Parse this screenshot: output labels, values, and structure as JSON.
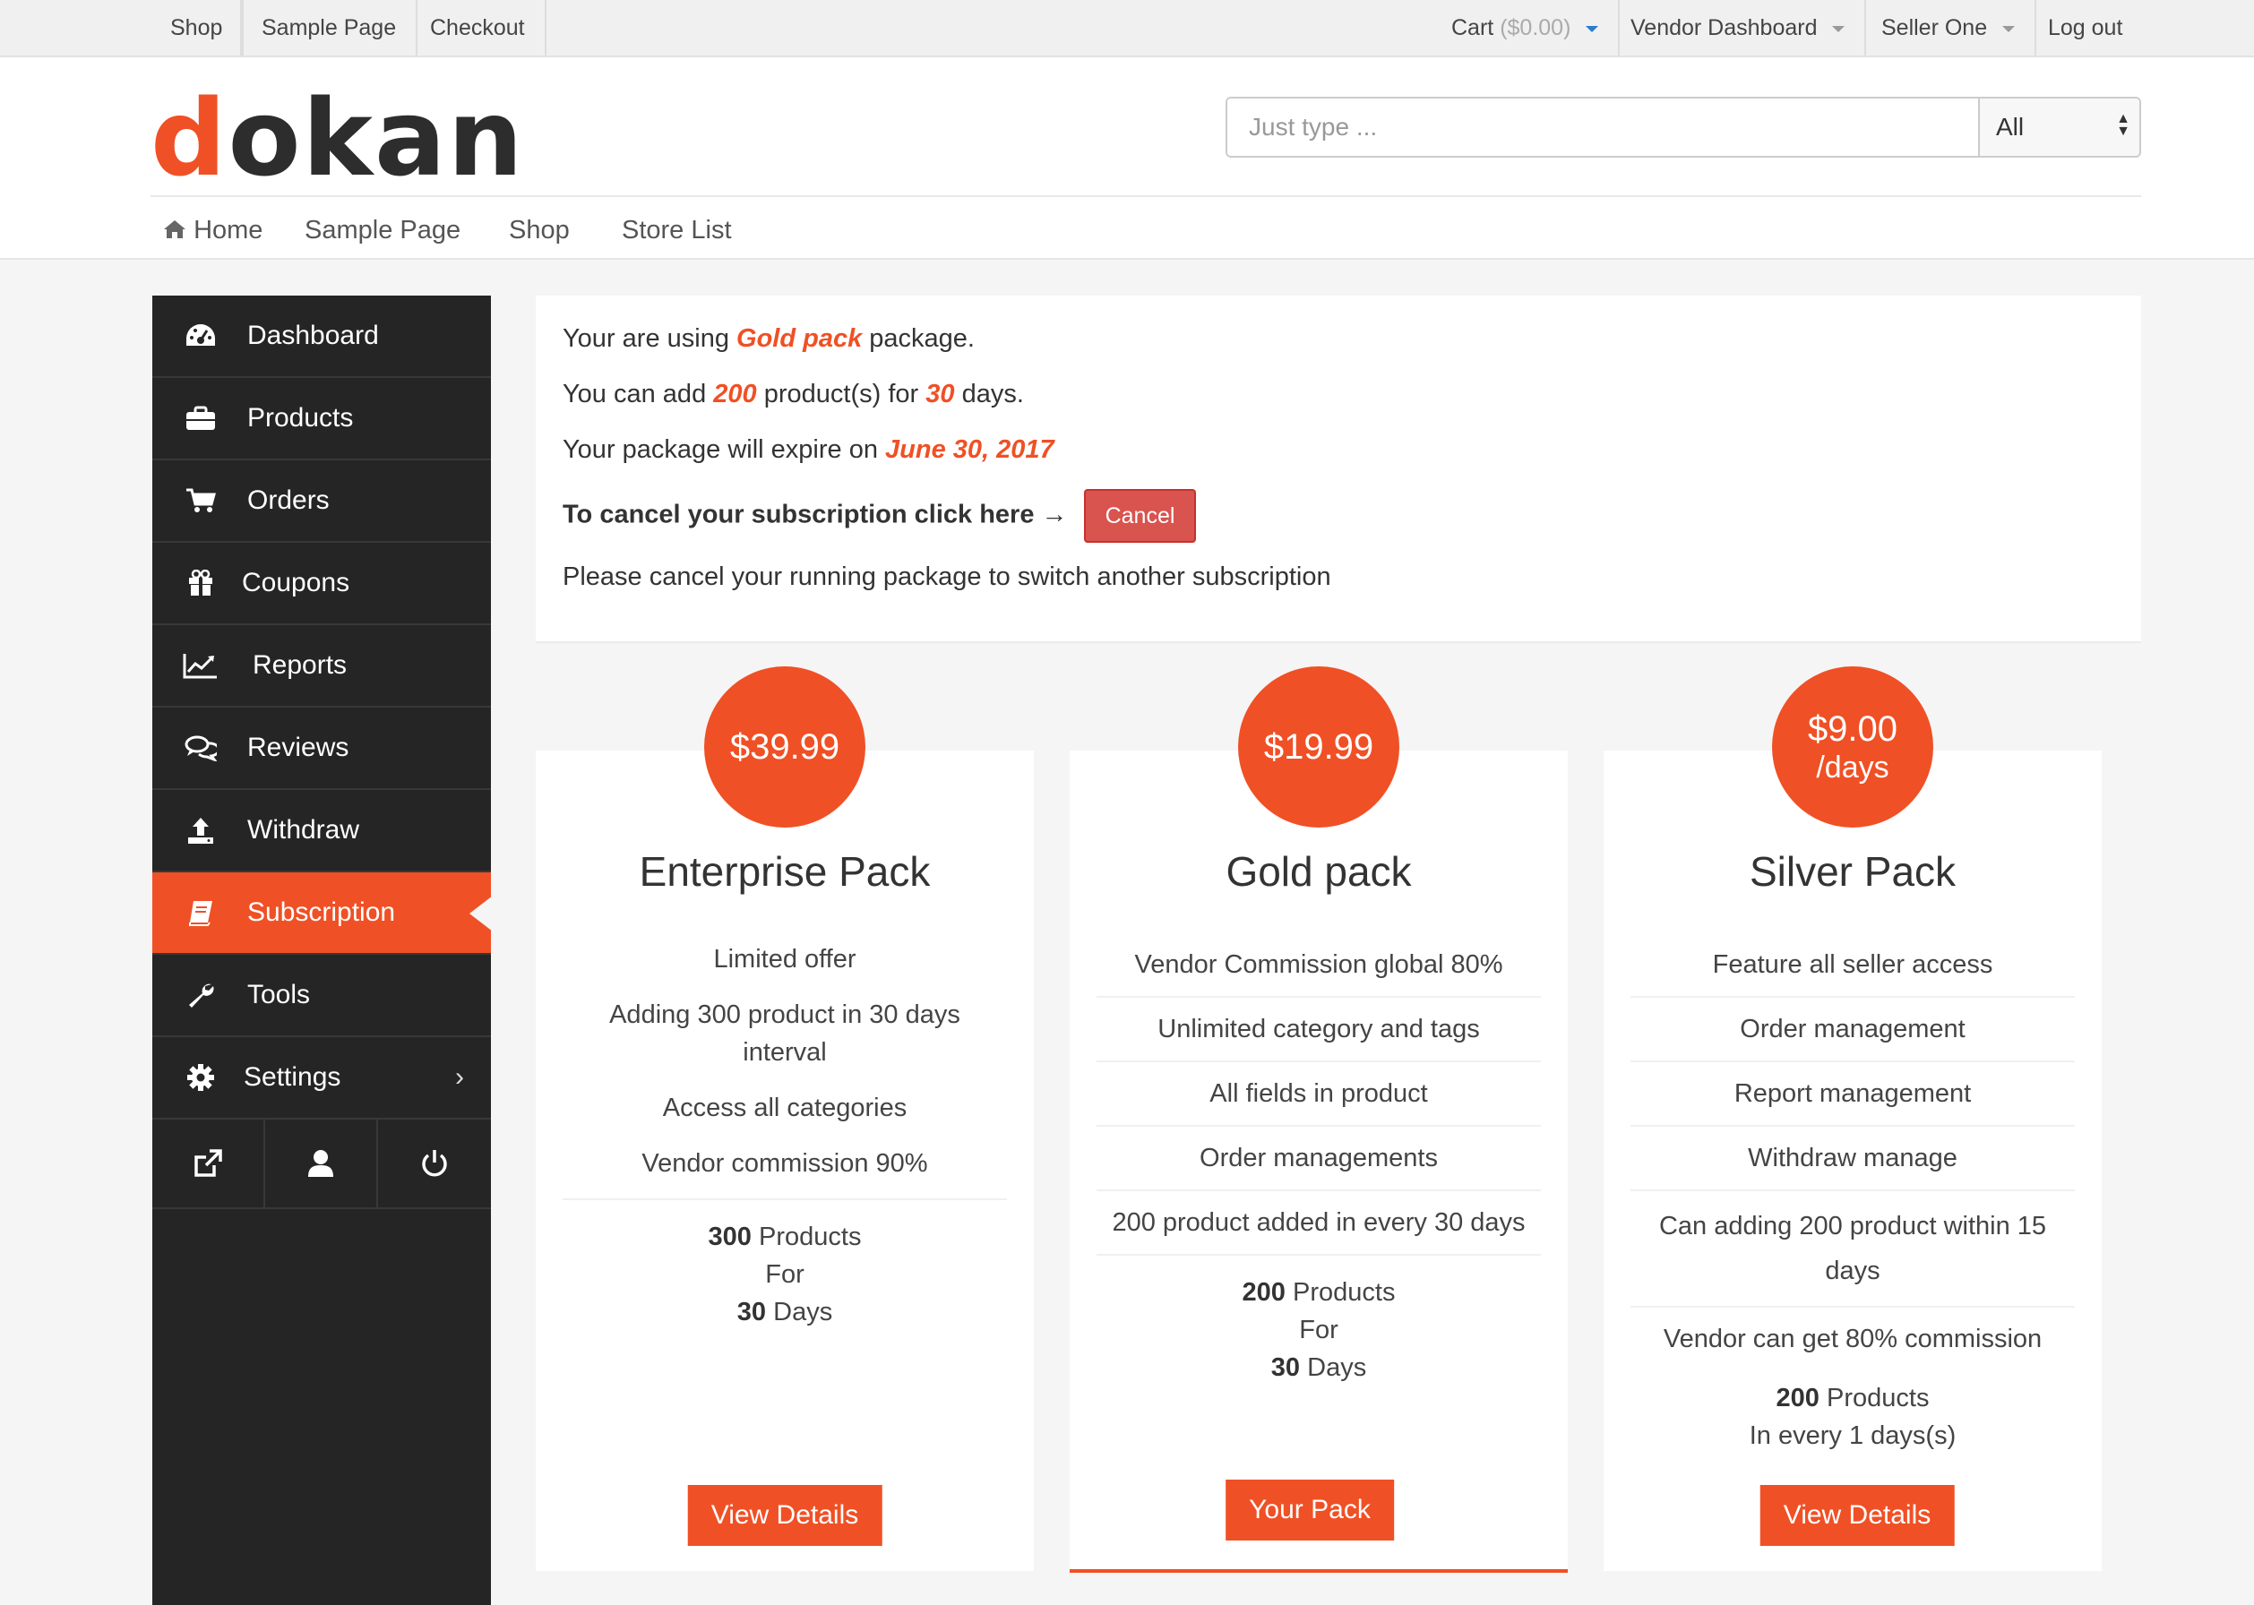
{
  "topbar": {
    "left": [
      "Shop",
      "Sample Page",
      "Checkout"
    ],
    "cart_label": "Cart",
    "cart_amount": "($0.00)",
    "vendor_dashboard": "Vendor Dashboard",
    "user": "Seller One",
    "logout": "Log out"
  },
  "logo": {
    "first": "d",
    "rest": "okan"
  },
  "search": {
    "placeholder": "Just type ...",
    "category": "All"
  },
  "mainnav": [
    "Home",
    "Sample Page",
    "Shop",
    "Store List"
  ],
  "sidebar": {
    "items": [
      {
        "label": "Dashboard",
        "icon": "dashboard-icon"
      },
      {
        "label": "Products",
        "icon": "briefcase-icon"
      },
      {
        "label": "Orders",
        "icon": "cart-icon"
      },
      {
        "label": "Coupons",
        "icon": "gift-icon"
      },
      {
        "label": "Reports",
        "icon": "chart-icon"
      },
      {
        "label": "Reviews",
        "icon": "comments-icon"
      },
      {
        "label": "Withdraw",
        "icon": "upload-icon"
      },
      {
        "label": "Subscription",
        "icon": "book-icon",
        "active": true
      },
      {
        "label": "Tools",
        "icon": "wrench-icon"
      },
      {
        "label": "Settings",
        "icon": "gear-icon"
      }
    ],
    "bottom": [
      "external-link-icon",
      "user-icon",
      "power-icon"
    ]
  },
  "info": {
    "line1_pre": "Your are using",
    "line1_pack": "Gold pack",
    "line1_post": "package.",
    "line2_pre": "You can add",
    "line2_count": "200",
    "line2_mid": "product(s) for",
    "line2_days": "30",
    "line2_post": "days.",
    "line3_pre": "Your package will expire on",
    "line3_date": "June 30, 2017",
    "cancel_text": "To cancel your subscription click here →",
    "cancel_button": "Cancel",
    "line5": "Please cancel your running package to switch another subscription"
  },
  "packs": [
    {
      "price": "$39.99",
      "period": "",
      "title": "Enterprise Pack",
      "features": [
        "Limited offer",
        "Adding 300 product in 30 days interval",
        "Access all categories",
        "Vendor commission 90%"
      ],
      "count": "300",
      "count_label": "Products",
      "for_label": "For",
      "days": "30",
      "days_label": "Days",
      "button": "View Details"
    },
    {
      "price": "$19.99",
      "period": "",
      "title": "Gold pack",
      "features": [
        "Vendor Commission global 80%",
        "Unlimited category and tags",
        "All fields in product",
        "Order managements",
        "200 product added in every 30 days"
      ],
      "count": "200",
      "count_label": "Products",
      "for_label": "For",
      "days": "30",
      "days_label": "Days",
      "button": "Your Pack",
      "current": true
    },
    {
      "price": "$9.00",
      "period": "/days",
      "title": "Silver Pack",
      "features": [
        "Feature all seller access",
        "Order management",
        "Report management",
        "Withdraw manage",
        "Can adding 200 product within 15 days",
        "Vendor can get 80% commission"
      ],
      "count": "200",
      "count_label": "Products",
      "in_every": "In every 1 days(s)",
      "button": "View Details"
    }
  ],
  "colors": {
    "accent": "#f05025",
    "sidebar": "#252525",
    "cancel": "#d9534f"
  }
}
